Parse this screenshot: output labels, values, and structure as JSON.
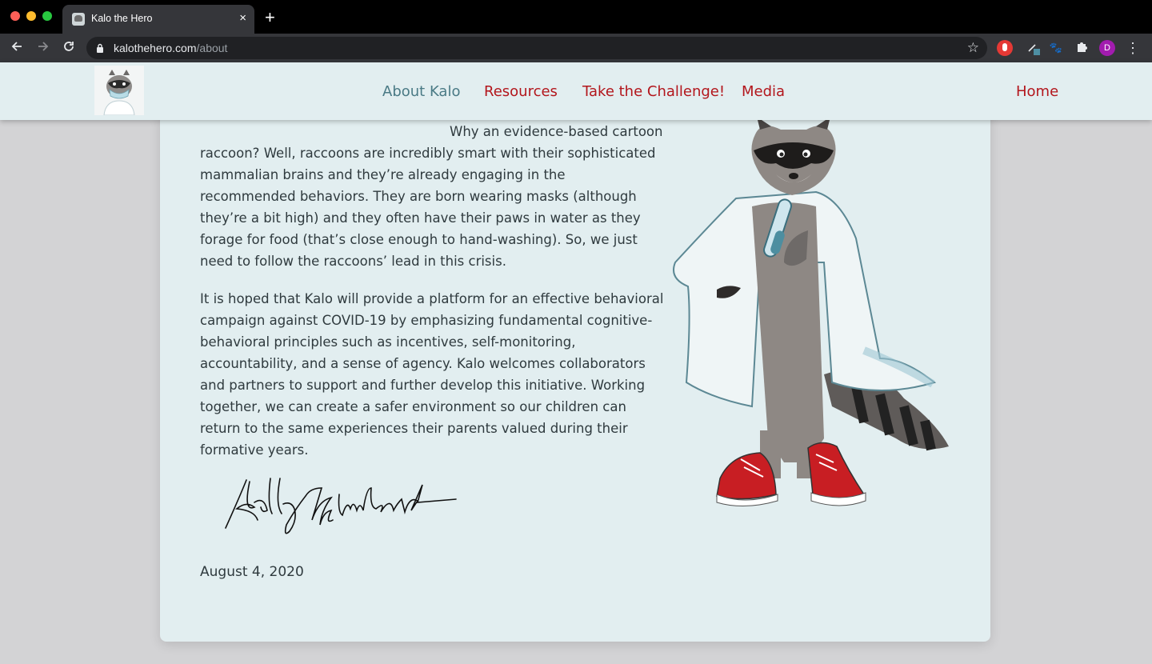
{
  "browser": {
    "tab_title": "Kalo the Hero",
    "tab_close": "×",
    "new_tab": "+",
    "url_host": "kalothehero.com",
    "url_path": "/about",
    "profile_initial": "D"
  },
  "nav": {
    "links": [
      "About Kalo",
      "Resources",
      "Take the Challenge!",
      "Media"
    ],
    "home": "Home",
    "active_color": "#4a7a85",
    "link_color": "#b3161c"
  },
  "content": {
    "paragraph1": "Why an evidence-based cartoon raccoon? Well, raccoons are incredibly smart with their sophisticated mammalian brains and they’re already engaging in the recommended behaviors. They are born wearing masks (although they’re a bit high) and they often have their paws in water as they forage for food (that’s close enough to hand-washing). So, we just need to follow the raccoons’ lead in this crisis.",
    "paragraph2": "It is hoped that Kalo will provide a platform for an effective behavioral campaign against COVID-19 by emphasizing fundamental cognitive-behavioral principles such as incentives, self-monitoring, accountability, and a sense of agency. Kalo welcomes collaborators and partners to support and further develop this initiative. Working together, we can create a safer environment so our children can return to the same experiences their parents valued during their formative years.",
    "signature": "Kelly G Lambert",
    "date": "August 4, 2020"
  },
  "icons": {
    "back": "arrow-left-icon",
    "forward": "arrow-right-icon",
    "reload": "reload-icon",
    "lock": "lock-icon",
    "bookmark": "star-icon",
    "extensions": "puzzle-icon",
    "menu": "kebab-menu-icon"
  }
}
